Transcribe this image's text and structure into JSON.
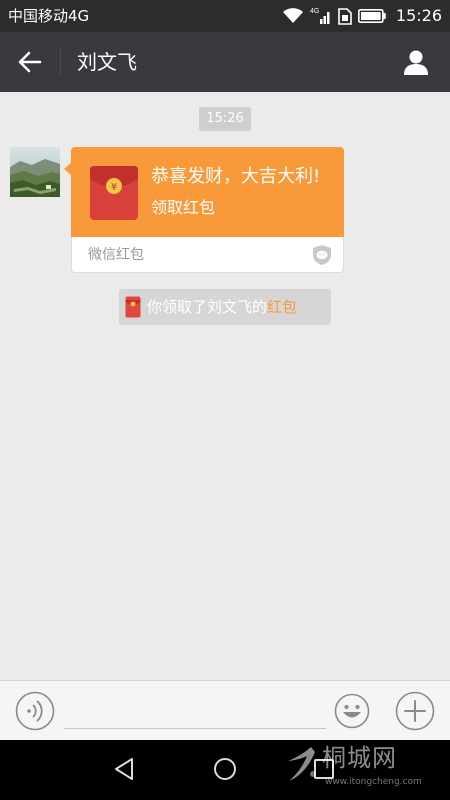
{
  "status_bar": {
    "carrier": "中国移动4G",
    "network_type": "4G",
    "time": "15:26"
  },
  "header": {
    "title": "刘文飞"
  },
  "chat": {
    "timestamp": "15:26",
    "red_packet": {
      "greeting": "恭喜发财，大吉大利!",
      "action": "领取红包",
      "source": "微信红包",
      "color": "#f99a3a"
    },
    "notice": {
      "text": "你领取了刘文飞的",
      "link": "红包"
    }
  },
  "input_bar": {
    "message_value": ""
  },
  "watermark": {
    "text": "桐城网",
    "url": "www.itongcheng.com"
  },
  "icons": {
    "back": "arrow-left-icon",
    "profile": "person-icon",
    "voice": "voice-icon",
    "emoji": "smiley-icon",
    "more": "plus-icon"
  }
}
